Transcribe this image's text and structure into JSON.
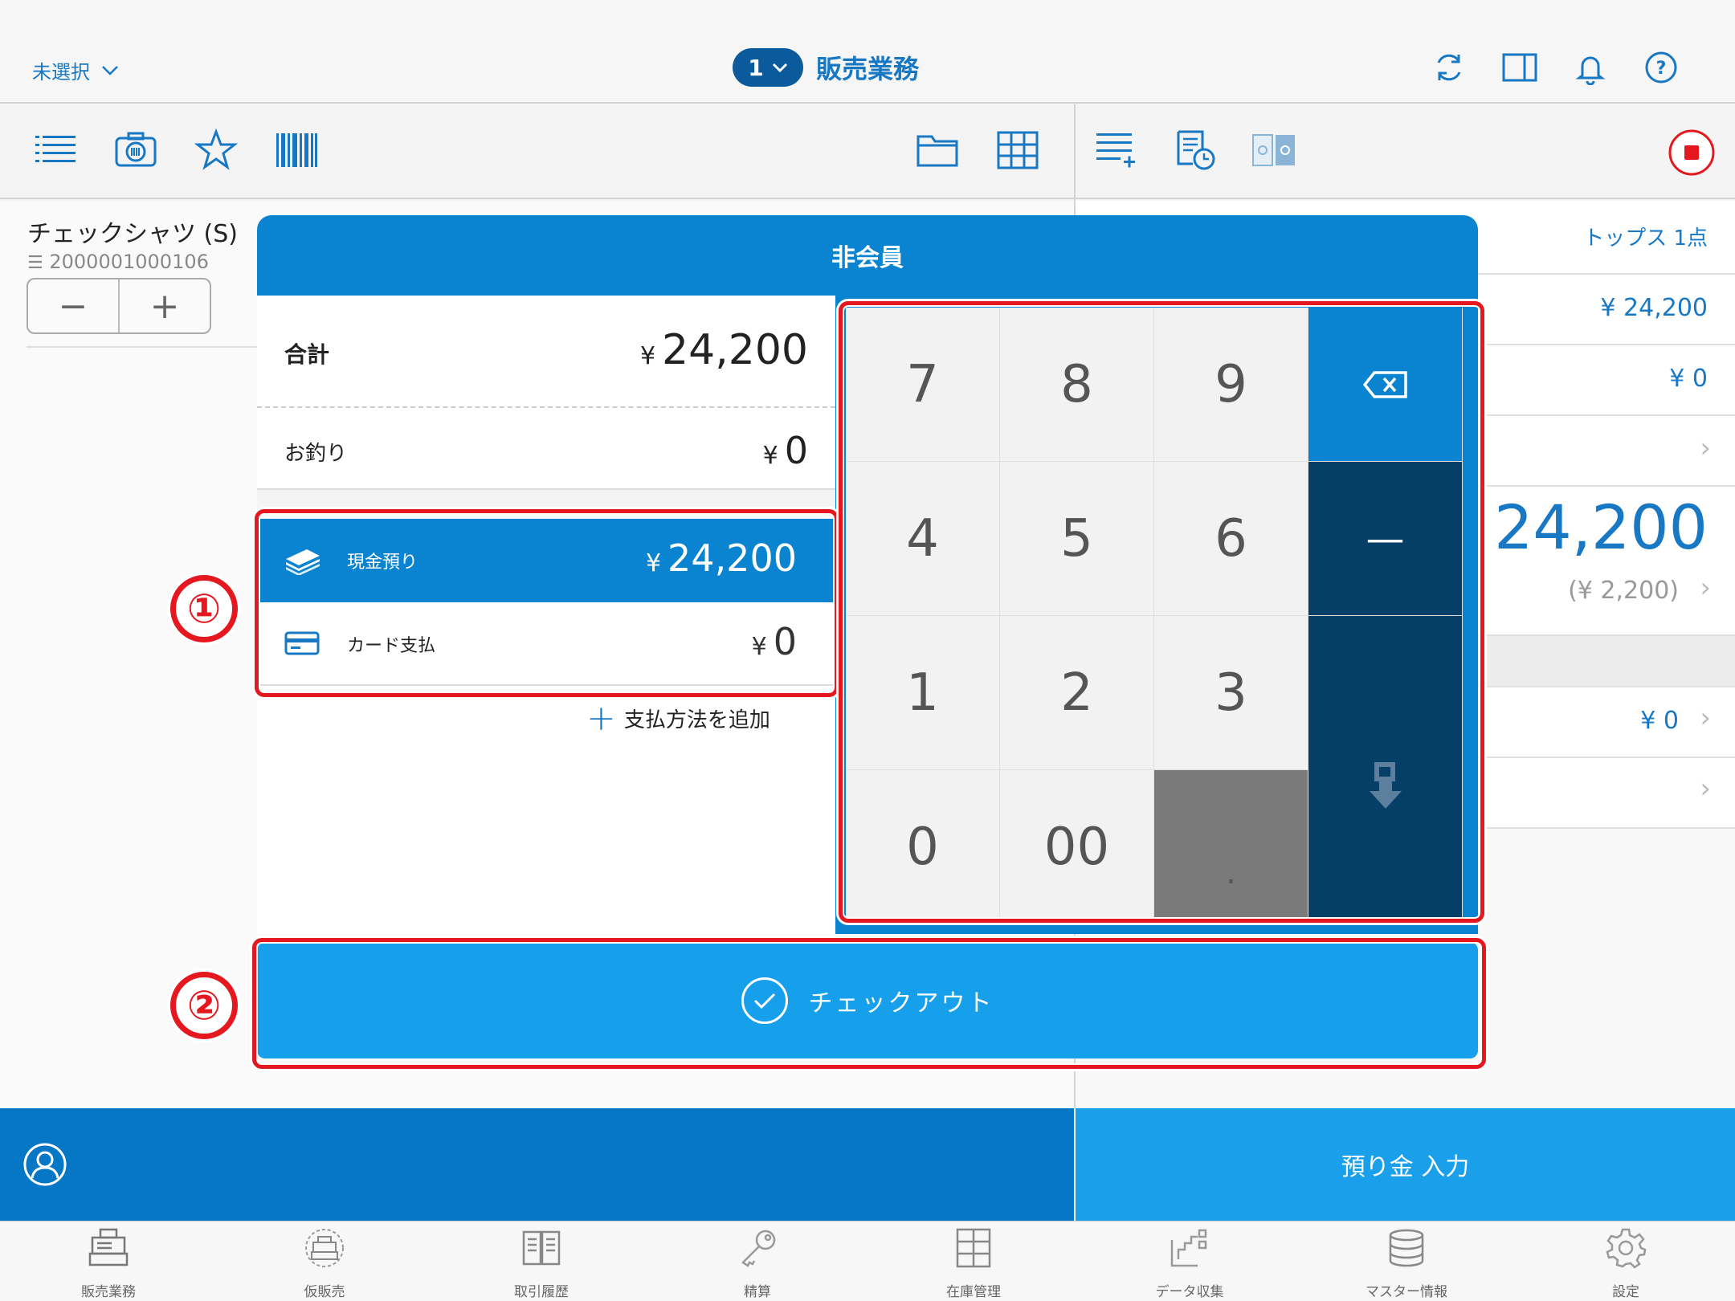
{
  "header": {
    "store_select": "未選択",
    "register_number": "1",
    "title": "販売業務"
  },
  "item": {
    "name": "チェックシャツ (S)",
    "code": "2000001000106",
    "minus": "−",
    "plus": "+"
  },
  "summary_panel": {
    "category_summary": "トップス 1点",
    "amount1": "¥ 24,200",
    "amount2": "¥ 0",
    "total_large": "¥ 24,200",
    "tax": "(¥ 2,200)",
    "amount3": "¥ 0"
  },
  "modal": {
    "title": "非会員",
    "total_label": "合計",
    "total_yen": "¥",
    "total_value": "24,200",
    "change_label": "お釣り",
    "change_yen": "¥",
    "change_value": "0",
    "payments": [
      {
        "label": "現金預り",
        "yen": "¥",
        "value": "24,200",
        "icon": "cash-icon"
      },
      {
        "label": "カード支払",
        "yen": "¥",
        "value": "0",
        "icon": "card-icon"
      }
    ],
    "add_payment": "支払方法を追加",
    "keys": [
      "7",
      "8",
      "9",
      "4",
      "5",
      "6",
      "1",
      "2",
      "3",
      "0",
      "00",
      "."
    ],
    "minus_key": "—",
    "checkout": "チェックアウト"
  },
  "bottom": {
    "deposit_input": "預り金 入力"
  },
  "tabs": [
    {
      "label": "販売業務",
      "icon": "register-icon"
    },
    {
      "label": "仮販売",
      "icon": "temp-sale-icon"
    },
    {
      "label": "取引履歴",
      "icon": "history-book-icon"
    },
    {
      "label": "精算",
      "icon": "key-icon"
    },
    {
      "label": "在庫管理",
      "icon": "inventory-icon"
    },
    {
      "label": "データ収集",
      "icon": "data-collect-icon"
    },
    {
      "label": "マスター情報",
      "icon": "database-icon"
    },
    {
      "label": "設定",
      "icon": "gear-icon"
    }
  ],
  "annotations": [
    "①",
    "②"
  ],
  "colors": {
    "accent": "#0a84d0",
    "dark_key": "#053e66",
    "checkout": "#16a0ec",
    "annotation": "#e5171f"
  }
}
